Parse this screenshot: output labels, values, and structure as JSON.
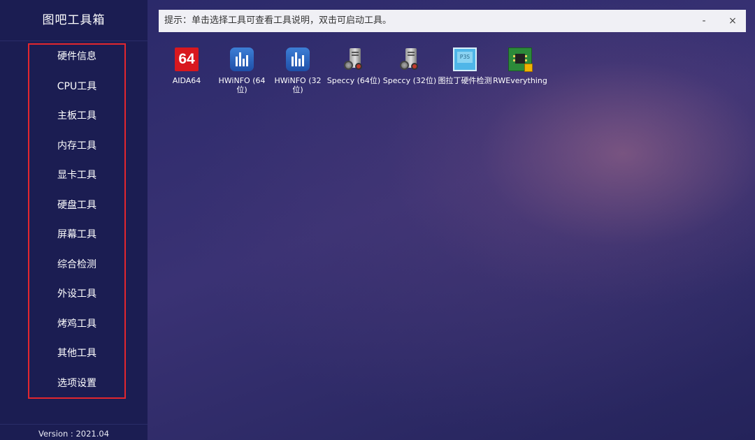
{
  "app": {
    "title": "图吧工具箱",
    "version": "Version : 2021.04"
  },
  "menu": [
    {
      "id": "hardware-info",
      "label": "硬件信息"
    },
    {
      "id": "cpu-tools",
      "label": "CPU工具"
    },
    {
      "id": "motherboard-tools",
      "label": "主板工具"
    },
    {
      "id": "memory-tools",
      "label": "内存工具"
    },
    {
      "id": "gpu-tools",
      "label": "显卡工具"
    },
    {
      "id": "disk-tools",
      "label": "硬盘工具"
    },
    {
      "id": "screen-tools",
      "label": "屏幕工具"
    },
    {
      "id": "comprehensive-test",
      "label": "综合检测"
    },
    {
      "id": "peripheral-tools",
      "label": "外设工具"
    },
    {
      "id": "stress-tools",
      "label": "烤鸡工具"
    },
    {
      "id": "other-tools",
      "label": "其他工具"
    },
    {
      "id": "settings",
      "label": "选项设置"
    }
  ],
  "hint": {
    "text": "提示：单击选择工具可查看工具说明，双击可启动工具。",
    "minimize": "-",
    "close": "×"
  },
  "tools": [
    {
      "label": "AIDA64",
      "icon": "aida64-icon",
      "badge": "64"
    },
    {
      "label": "HWiNFO (64位)",
      "icon": "hwinfo-icon"
    },
    {
      "label": "HWiNFO (32位)",
      "icon": "hwinfo-icon"
    },
    {
      "label": "Speccy (64位)",
      "icon": "speccy-icon"
    },
    {
      "label": "Speccy (32位)",
      "icon": "speccy-icon"
    },
    {
      "label": "图拉丁硬件检测",
      "icon": "p3s-icon",
      "badge": "P3S"
    },
    {
      "label": "RWEverything",
      "icon": "rweverything-icon"
    }
  ]
}
